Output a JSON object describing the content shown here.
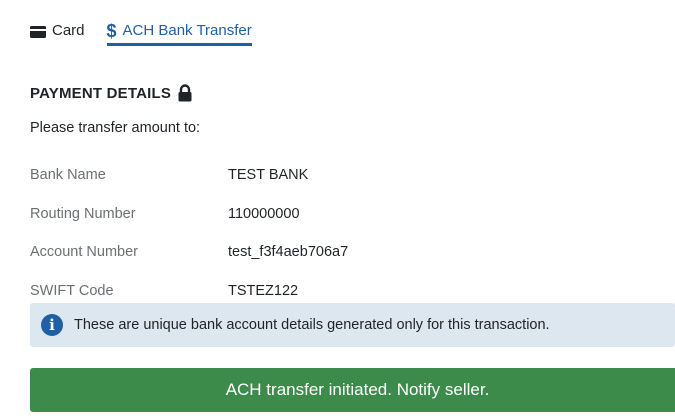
{
  "tabs": [
    {
      "label": "Card",
      "icon": "credit-card-icon",
      "active": false
    },
    {
      "label": "ACH Bank Transfer",
      "icon": "dollar-icon",
      "active": true
    }
  ],
  "payment_details": {
    "title": "PAYMENT DETAILS",
    "title_icon": "lock-icon",
    "instruction": "Please transfer amount to:",
    "rows": [
      {
        "label": "Bank Name",
        "value": "TEST BANK"
      },
      {
        "label": "Routing Number",
        "value": "110000000"
      },
      {
        "label": "Account Number",
        "value": "test_f3f4aeb706a7"
      },
      {
        "label": "SWIFT Code",
        "value": "TSTEZ122"
      }
    ]
  },
  "info_alert": {
    "icon": "info-icon",
    "text": "These are unique bank account details generated only for this transaction."
  },
  "action_button": {
    "label": "ACH transfer initiated. Notify seller."
  },
  "colors": {
    "accent": "#1f5fa6",
    "alert_bg": "#dde7f0",
    "success": "#3d8b4a"
  }
}
